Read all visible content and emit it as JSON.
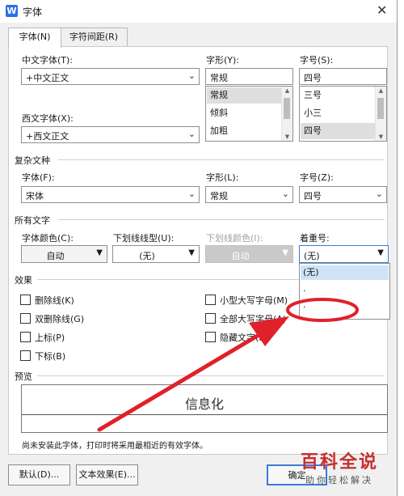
{
  "window": {
    "title": "字体",
    "app_icon": "W"
  },
  "tabs": [
    {
      "label": "字体(N)"
    },
    {
      "label": "字符间距(R)"
    }
  ],
  "cjk_font": {
    "label": "中文字体(T):",
    "value": "+中文正文"
  },
  "western_font": {
    "label": "西文字体(X):",
    "value": "+西文正文"
  },
  "style": {
    "label": "字形(Y):",
    "value": "常规",
    "options": [
      "常规",
      "倾斜",
      "加粗"
    ],
    "selected": "常规"
  },
  "size": {
    "label": "字号(S):",
    "value": "四号",
    "options": [
      "三号",
      "小三",
      "四号"
    ],
    "selected": "四号"
  },
  "complex": {
    "section": "复杂文种",
    "font_label": "字体(F):",
    "font_value": "宋体",
    "style_label": "字形(L):",
    "style_value": "常规",
    "size_label": "字号(Z):",
    "size_value": "四号"
  },
  "all_text": {
    "section": "所有文字",
    "color_label": "字体颜色(C):",
    "color_value": "自动",
    "underline_label": "下划线线型(U):",
    "underline_value": "(无)",
    "underline_color_label": "下划线颜色(I):",
    "underline_color_value": "自动",
    "emphasis_label": "着重号:",
    "emphasis_value": "(无)",
    "emphasis_options": [
      "(无)",
      ".",
      "."
    ]
  },
  "effects": {
    "section": "效果",
    "items": [
      "删除线(K)",
      "双删除线(G)",
      "上标(P)",
      "下标(B)",
      "小型大写字母(M)",
      "全部大写字母(A)",
      "隐藏文字(H)"
    ]
  },
  "preview": {
    "section": "预览",
    "text": "信息化"
  },
  "note": "尚未安装此字体，打印时将采用最相近的有效字体。",
  "buttons": {
    "default": "默认(D)...",
    "text_effects": "文本效果(E)...",
    "ok": "确定"
  },
  "watermark": {
    "brand": "百科全说",
    "tagline": "助你轻松解决"
  },
  "colors": {
    "annotation": "#e0212a",
    "focus": "#3c7ad8",
    "icon": "#2f6ee8"
  }
}
